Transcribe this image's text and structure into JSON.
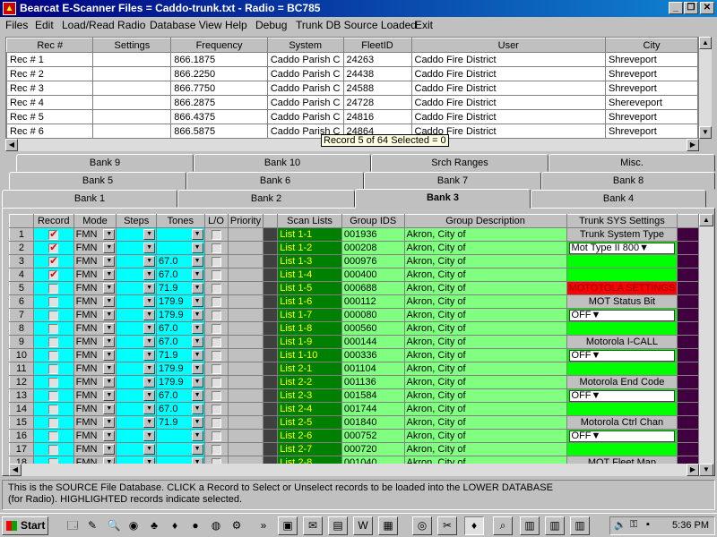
{
  "window": {
    "title": "Bearcat E-Scanner Files = Caddo-trunk.txt - Radio = BC785"
  },
  "menu": [
    "Files",
    "Edit",
    "Load/Read Radio",
    "Database View",
    "Help",
    "Debug",
    "Trunk DB Source Loaded",
    "Exit"
  ],
  "source_grid": {
    "columns": [
      "Rec #",
      "Settings",
      "Frequency",
      "System",
      "FleetID",
      "User",
      "City"
    ],
    "rows": [
      [
        "Rec # 1",
        "",
        "866.1875",
        "Caddo Parish C",
        "24263",
        "Caddo Fire District",
        "Shreveport"
      ],
      [
        "Rec # 2",
        "",
        "866.2250",
        "Caddo Parish C",
        "24438",
        "Caddo Fire District",
        "Shreveport"
      ],
      [
        "Rec # 3",
        "",
        "866.7750",
        "Caddo Parish C",
        "24588",
        "Caddo Fire District",
        "Shreveport"
      ],
      [
        "Rec # 4",
        "",
        "866.2875",
        "Caddo Parish C",
        "24728",
        "Caddo Fire District",
        "Shereveport"
      ],
      [
        "Rec # 5",
        "",
        "866.4375",
        "Caddo Parish C",
        "24816",
        "Caddo Fire District",
        "Shreveport"
      ],
      [
        "Rec # 6",
        "",
        "866.5875",
        "Caddo Parish C",
        "24864",
        "Caddo Fire District",
        "Shreveport"
      ]
    ]
  },
  "tooltip": "Record 5 of 64 Selected = 0",
  "tabs": {
    "row1": [
      "Bank 9",
      "Bank 10",
      "Srch Ranges",
      "Misc."
    ],
    "row2": [
      "Bank 5",
      "Bank 6",
      "Bank 7",
      "Bank 8"
    ],
    "row3": [
      "Bank 1",
      "Bank 2",
      "Bank 3",
      "Bank 4"
    ],
    "active": "Bank 3"
  },
  "bank_grid": {
    "columns": [
      "",
      "Record",
      "Mode",
      "Steps",
      "Tones",
      "L/O",
      "Priority",
      "",
      "Scan Lists",
      "Group IDS",
      "Group Description",
      "Trunk SYS Settings"
    ],
    "rows": [
      {
        "n": "1",
        "rec": true,
        "mode": "FMN",
        "tone": "",
        "scan": "List 1-1",
        "gid": "001936",
        "desc": "Akron, City of"
      },
      {
        "n": "2",
        "rec": true,
        "mode": "FMN",
        "tone": "",
        "scan": "List 1-2",
        "gid": "000208",
        "desc": "Akron, City of"
      },
      {
        "n": "3",
        "rec": true,
        "mode": "FMN",
        "tone": "67.0",
        "scan": "List 1-3",
        "gid": "000976",
        "desc": "Akron, City of"
      },
      {
        "n": "4",
        "rec": true,
        "mode": "FMN",
        "tone": "67.0",
        "scan": "List 1-4",
        "gid": "000400",
        "desc": "Akron, City of"
      },
      {
        "n": "5",
        "rec": false,
        "mode": "FMN",
        "tone": "71.9",
        "scan": "List 1-5",
        "gid": "000688",
        "desc": "Akron, City of"
      },
      {
        "n": "6",
        "rec": false,
        "mode": "FMN",
        "tone": "179.9",
        "scan": "List 1-6",
        "gid": "000112",
        "desc": "Akron, City of"
      },
      {
        "n": "7",
        "rec": false,
        "mode": "FMN",
        "tone": "179.9",
        "scan": "List 1-7",
        "gid": "000080",
        "desc": "Akron, City of"
      },
      {
        "n": "8",
        "rec": false,
        "mode": "FMN",
        "tone": "67.0",
        "scan": "List 1-8",
        "gid": "000560",
        "desc": "Akron, City of"
      },
      {
        "n": "9",
        "rec": false,
        "mode": "FMN",
        "tone": "67.0",
        "scan": "List 1-9",
        "gid": "000144",
        "desc": "Akron, City of"
      },
      {
        "n": "10",
        "rec": false,
        "mode": "FMN",
        "tone": "71.9",
        "scan": "List 1-10",
        "gid": "000336",
        "desc": "Akron, City of"
      },
      {
        "n": "11",
        "rec": false,
        "mode": "FMN",
        "tone": "179.9",
        "scan": "List 2-1",
        "gid": "001104",
        "desc": "Akron, City of"
      },
      {
        "n": "12",
        "rec": false,
        "mode": "FMN",
        "tone": "179.9",
        "scan": "List 2-2",
        "gid": "001136",
        "desc": "Akron, City of"
      },
      {
        "n": "13",
        "rec": false,
        "mode": "FMN",
        "tone": "67.0",
        "scan": "List 2-3",
        "gid": "001584",
        "desc": "Akron, City of"
      },
      {
        "n": "14",
        "rec": false,
        "mode": "FMN",
        "tone": "67.0",
        "scan": "List 2-4",
        "gid": "001744",
        "desc": "Akron, City of"
      },
      {
        "n": "15",
        "rec": false,
        "mode": "FMN",
        "tone": "71.9",
        "scan": "List 2-5",
        "gid": "001840",
        "desc": "Akron, City of"
      },
      {
        "n": "16",
        "rec": false,
        "mode": "FMN",
        "tone": "",
        "scan": "List 2-6",
        "gid": "000752",
        "desc": "Akron, City of"
      },
      {
        "n": "17",
        "rec": false,
        "mode": "FMN",
        "tone": "",
        "scan": "List 2-7",
        "gid": "000720",
        "desc": "Akron, City of"
      },
      {
        "n": "18",
        "rec": false,
        "mode": "FMN",
        "tone": "",
        "scan": "List 2-8",
        "gid": "001040",
        "desc": "Akron, City of"
      }
    ],
    "trunk_settings": [
      {
        "type": "label",
        "text": "Trunk System Type"
      },
      {
        "type": "select",
        "text": "Mot Type II 800"
      },
      {
        "type": "blank"
      },
      {
        "type": "blank"
      },
      {
        "type": "warn",
        "text": "MOTOTOLA SETTINGS"
      },
      {
        "type": "label",
        "text": "MOT Status Bit"
      },
      {
        "type": "select",
        "text": "OFF"
      },
      {
        "type": "blank"
      },
      {
        "type": "label",
        "text": "Motorola I-CALL"
      },
      {
        "type": "select",
        "text": "OFF"
      },
      {
        "type": "blank"
      },
      {
        "type": "label",
        "text": "Motorola End Code"
      },
      {
        "type": "select",
        "text": "OFF"
      },
      {
        "type": "blank"
      },
      {
        "type": "label",
        "text": "Motorola Ctrl Chan"
      },
      {
        "type": "select",
        "text": "OFF"
      },
      {
        "type": "blank"
      },
      {
        "type": "label",
        "text": "MOT Fleet Map"
      }
    ]
  },
  "status": {
    "line1": "This is the SOURCE File Database. CLICK a Record to Select or Unselect records to be loaded into the LOWER DATABASE",
    "line2": "(for Radio). HIGHLIGHTED records indicate selected."
  },
  "taskbar": {
    "start": "Start",
    "clock": "5:36 PM"
  },
  "colors": {
    "cyan": "#00ffff",
    "green_dark": "#008000",
    "green_light": "#80ff80",
    "green_bright": "#00ff00",
    "warn_red": "#ff0000",
    "purple": "#400040"
  }
}
